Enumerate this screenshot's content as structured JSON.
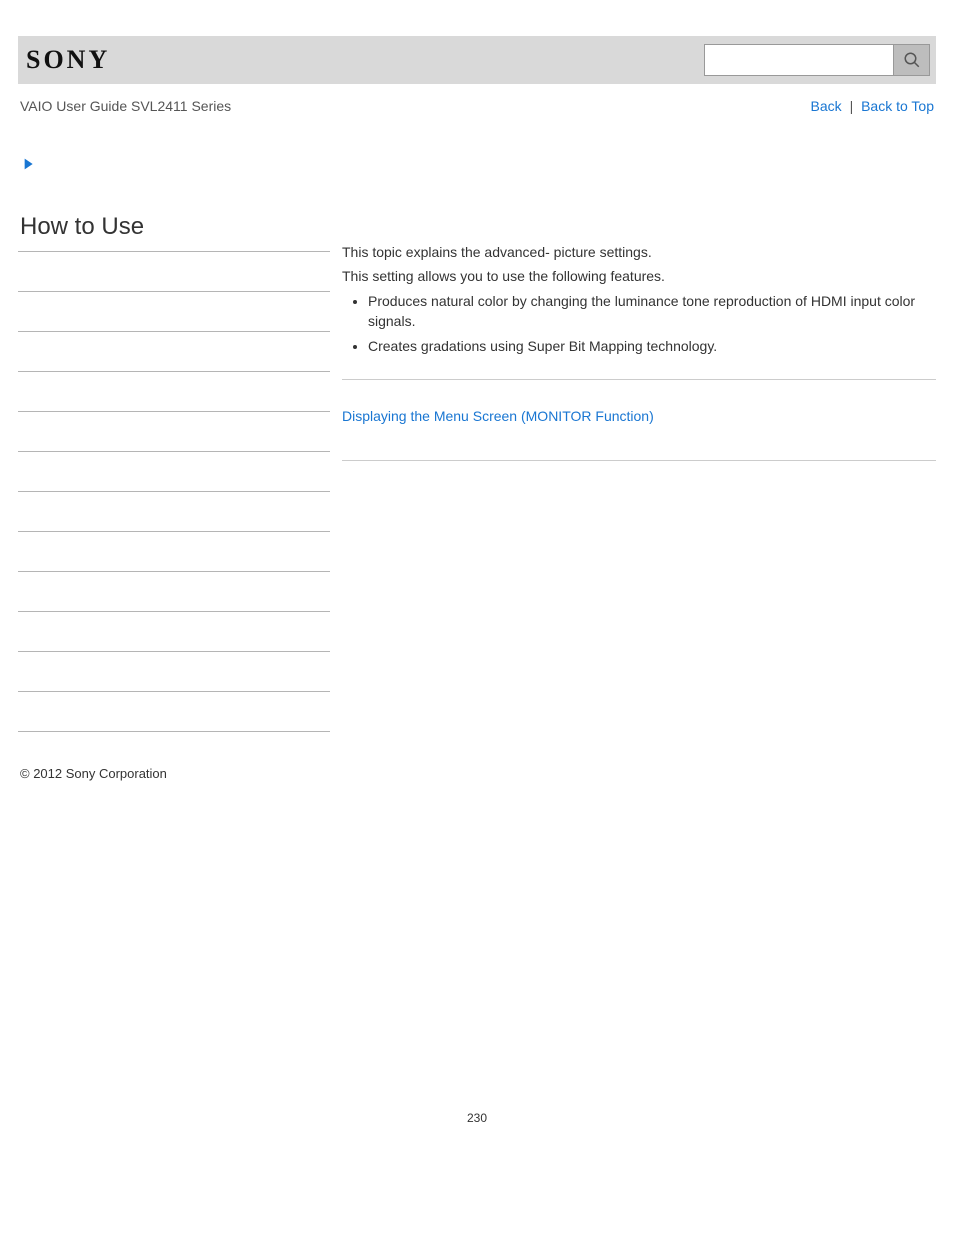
{
  "header": {
    "logo_text": "SONY",
    "search_placeholder": ""
  },
  "subheader": {
    "guide_title": "VAIO User Guide SVL2411 Series",
    "back_label": "Back",
    "back_to_top_label": "Back to Top",
    "separator": "|"
  },
  "sidebar": {
    "heading": "How to Use",
    "item_count": 12
  },
  "content": {
    "intro_line_1": "This topic explains the advanced- picture settings.",
    "intro_line_2": "This setting allows you to use the following features.",
    "bullets": [
      "Produces natural color by changing the luminance tone reproduction of HDMI input color signals.",
      "Creates gradations using Super Bit Mapping technology."
    ],
    "related_link": "Displaying the Menu Screen (MONITOR Function)"
  },
  "footer": {
    "copyright": "© 2012 Sony Corporation",
    "page_number": "230"
  }
}
